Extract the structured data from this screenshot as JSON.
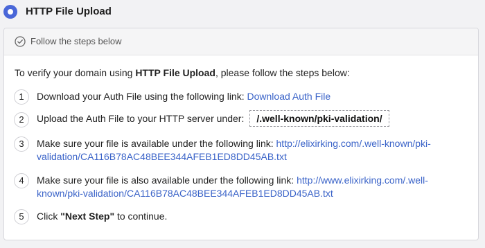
{
  "header": {
    "title": "HTTP File Upload"
  },
  "panel": {
    "heading": "Follow the steps below"
  },
  "intro": {
    "prefix": "To verify your domain using ",
    "method": "HTTP File Upload",
    "suffix": ", please follow the steps below:"
  },
  "steps": [
    {
      "num": "1",
      "text": "Download your Auth File using the following link: ",
      "link": "Download Auth File"
    },
    {
      "num": "2",
      "text": "Upload the Auth File to your HTTP server under:",
      "path": "/.well-known/pki-validation/"
    },
    {
      "num": "3",
      "text": "Make sure your file is available under the following link: ",
      "link_line1": "http://elixirking.com/.well-known/pki-",
      "link_line2": "validation/CA116B78AC48BEE344AFEB1ED8DD45AB.txt"
    },
    {
      "num": "4",
      "text": "Make sure your file is also available under the following link: ",
      "link_line1": "http://www.elixirking.com/.well-",
      "link_line2": "known/pki-validation/CA116B78AC48BEE344AFEB1ED8DD45AB.txt"
    },
    {
      "num": "5",
      "prefix": "Click ",
      "bold": "\"Next Step\"",
      "suffix": " to continue."
    }
  ],
  "colors": {
    "accent": "#4a67d8",
    "link": "#3a63c8"
  }
}
